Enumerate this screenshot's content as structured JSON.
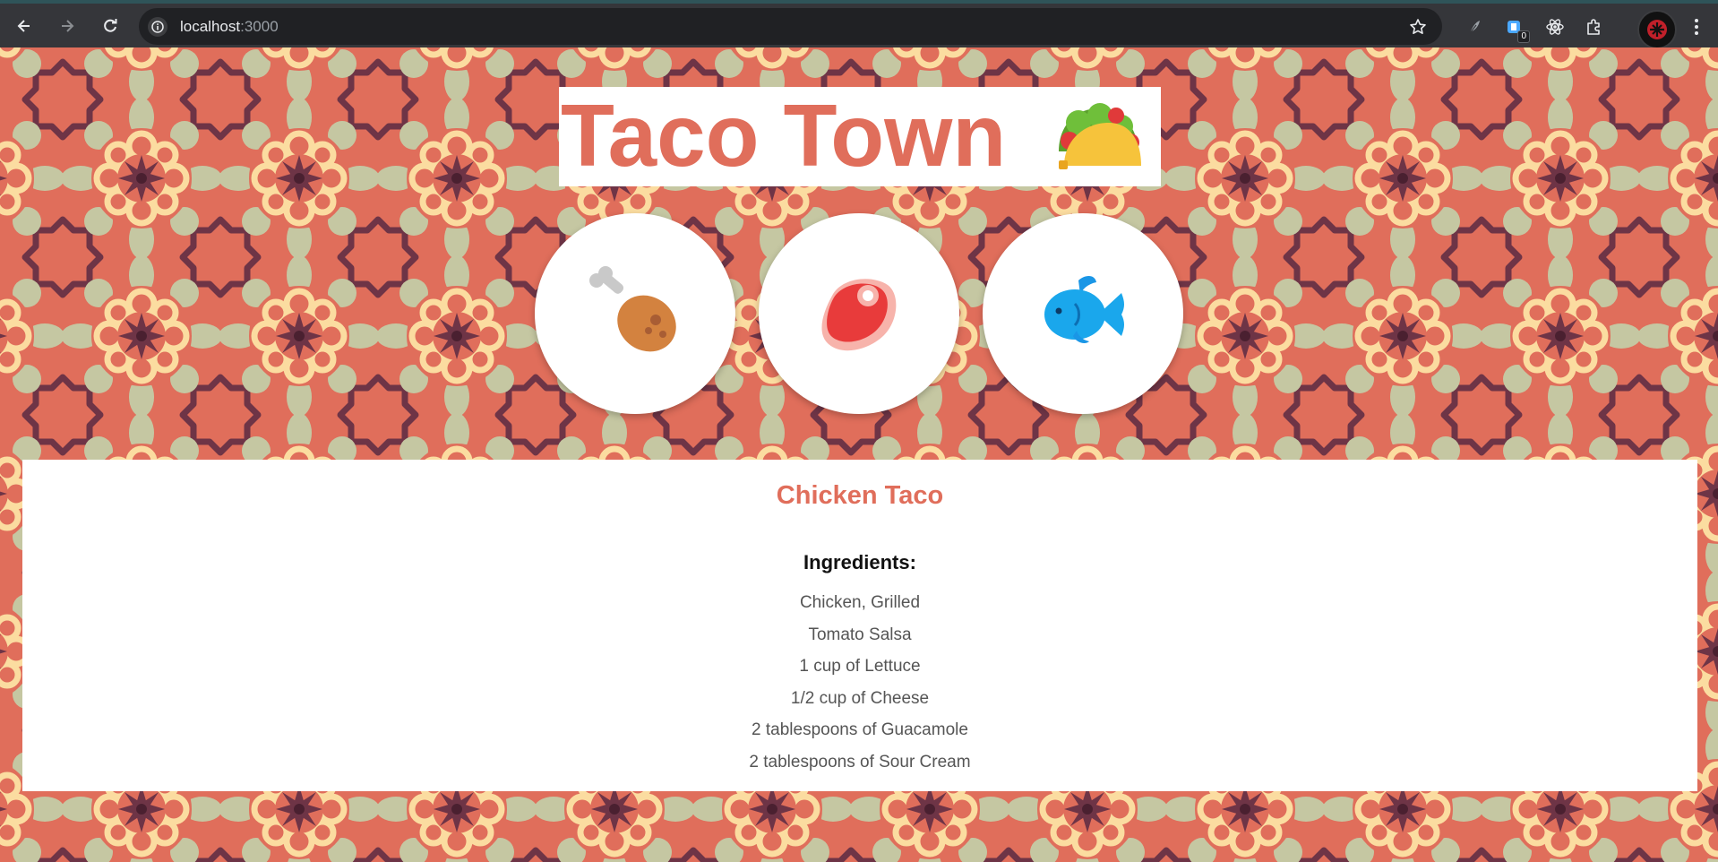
{
  "browser": {
    "url_host": "localhost",
    "url_port": ":3000",
    "extension_badge": "0"
  },
  "page": {
    "title": "Taco Town",
    "title_icon": "taco-icon",
    "meat_buttons": [
      {
        "icon": "chicken-leg-icon"
      },
      {
        "icon": "steak-icon"
      },
      {
        "icon": "fish-icon"
      }
    ],
    "recipe": {
      "title": "Chicken Taco",
      "ingredients_heading": "Ingredients:",
      "ingredients": [
        "Chicken, Grilled",
        "Tomato Salsa",
        "1 cup of Lettuce",
        "1/2 cup of Cheese",
        "2 tablespoons of Guacamole",
        "2 tablespoons of Sour Cream"
      ]
    }
  },
  "colors": {
    "accent": "#e06e5b",
    "pattern_sage": "#c5c7a2",
    "pattern_cream": "#fbdca0",
    "pattern_plum": "#6e3446"
  }
}
